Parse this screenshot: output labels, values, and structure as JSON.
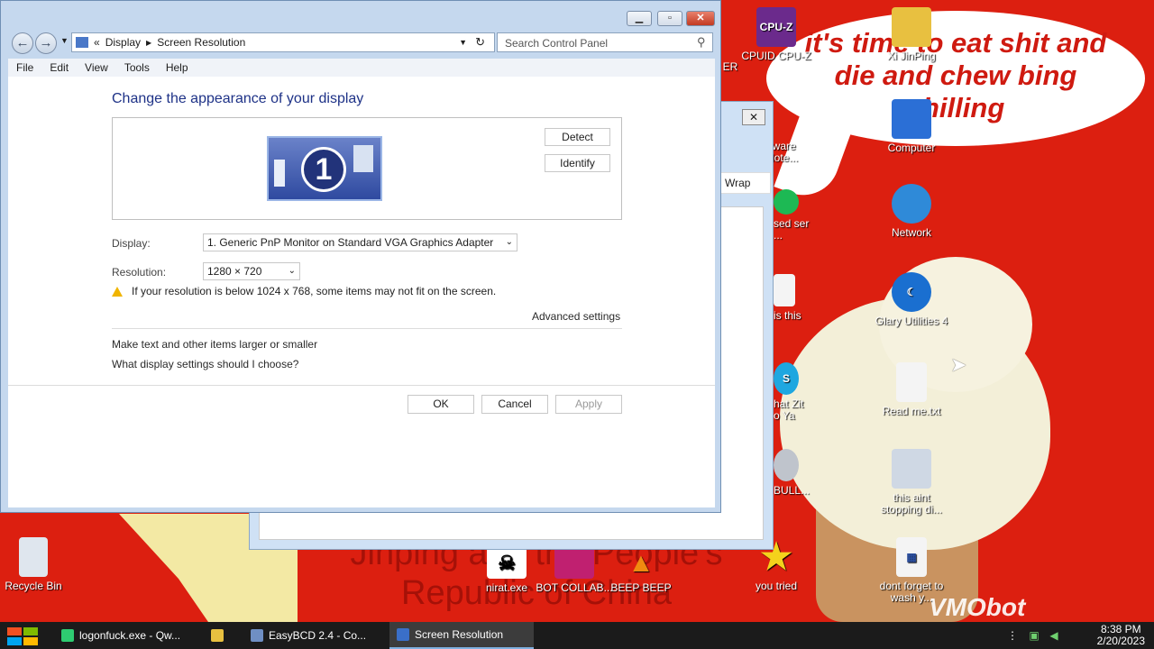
{
  "desktop": {
    "speech_bubble": "it's time to eat shit and die and chew bing chilling",
    "banner_text": "Jinping and the People's Republic of China",
    "watermark": "VMObot",
    "icons": {
      "cpuz": "CPUID CPU-Z",
      "xi": "Xi JinPing",
      "computer": "Computer",
      "network": "Network",
      "glary": "Glary Utilities 4",
      "readme": "Read me.txt",
      "notstopping": "this aint stopping di...",
      "dontforget": "dont forget to wash y...",
      "youtried": "you tried",
      "beep": "BEEP BEEP",
      "bot": "BOT COLLAB...",
      "nirat": "nirat.exe",
      "recycle": "Recycle Bin",
      "partial_er": "ER",
      "partial_note": "eware Note...",
      "partial_sed": "sed ser ...",
      "partial_this": "is this",
      "partial_zit": "hat Zit o Ya",
      "partial_bull": "BULL..."
    }
  },
  "bg_window": {
    "wrap_label": "Wrap"
  },
  "window": {
    "nav": {
      "breadcrumb_display": "Display",
      "breadcrumb_current": "Screen Resolution",
      "search_placeholder": "Search Control Panel"
    },
    "menu": [
      "File",
      "Edit",
      "View",
      "Tools",
      "Help"
    ],
    "heading": "Change the appearance of your display",
    "monitor_number": "1",
    "detect": "Detect",
    "identify": "Identify",
    "display_label": "Display:",
    "display_value": "1. Generic PnP Monitor on Standard VGA Graphics Adapter",
    "resolution_label": "Resolution:",
    "resolution_value": "1280 × 720",
    "warning": "If your resolution is below 1024 x 768, some items may not fit on the screen.",
    "advanced": "Advanced settings",
    "link_larger": "Make text and other items larger or smaller",
    "link_choose": "What display settings should I choose?",
    "ok": "OK",
    "cancel": "Cancel",
    "apply": "Apply"
  },
  "taskbar": {
    "items": [
      "logonfuck.exe - Qw...",
      "",
      "EasyBCD 2.4 - Co...",
      "Screen Resolution"
    ],
    "time": "8:38 PM",
    "date": "2/20/2023"
  }
}
